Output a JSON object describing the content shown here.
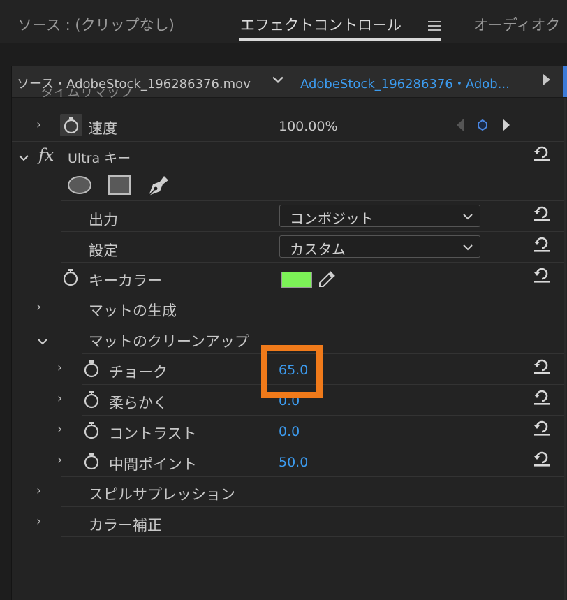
{
  "tabs": [
    {
      "label": "ソース : (クリップなし)"
    },
    {
      "label": "エフェクトコントロール"
    },
    {
      "label": "オーディオク"
    }
  ],
  "source_bar": {
    "source": "ソース・AdobeStock_196286376.mov",
    "sequence": "AdobeStock_196286376・Adob..."
  },
  "partial_row": "タイムリマップ",
  "speed": {
    "label": "速度",
    "value": "100.00%"
  },
  "effect": {
    "fx": "fx",
    "name": "Ultra キー"
  },
  "output": {
    "label": "出力",
    "value": "コンポジット"
  },
  "setting": {
    "label": "設定",
    "value": "カスタム"
  },
  "key_color": {
    "label": "キーカラー",
    "color": "#7cf257"
  },
  "matte_generation": {
    "label": "マットの生成"
  },
  "matte_cleanup": {
    "label": "マットのクリーンアップ",
    "items": [
      {
        "label": "チョーク",
        "value": "65.0"
      },
      {
        "label": "柔らかく",
        "value": "0.0"
      },
      {
        "label": "コントラスト",
        "value": "0.0"
      },
      {
        "label": "中間ポイント",
        "value": "50.0"
      }
    ]
  },
  "spill_suppression": {
    "label": "スピルサプレッション"
  },
  "color_correction": {
    "label": "カラー補正"
  },
  "colors": {
    "accent": "#3c9bef",
    "highlight": "#f07a1a"
  }
}
